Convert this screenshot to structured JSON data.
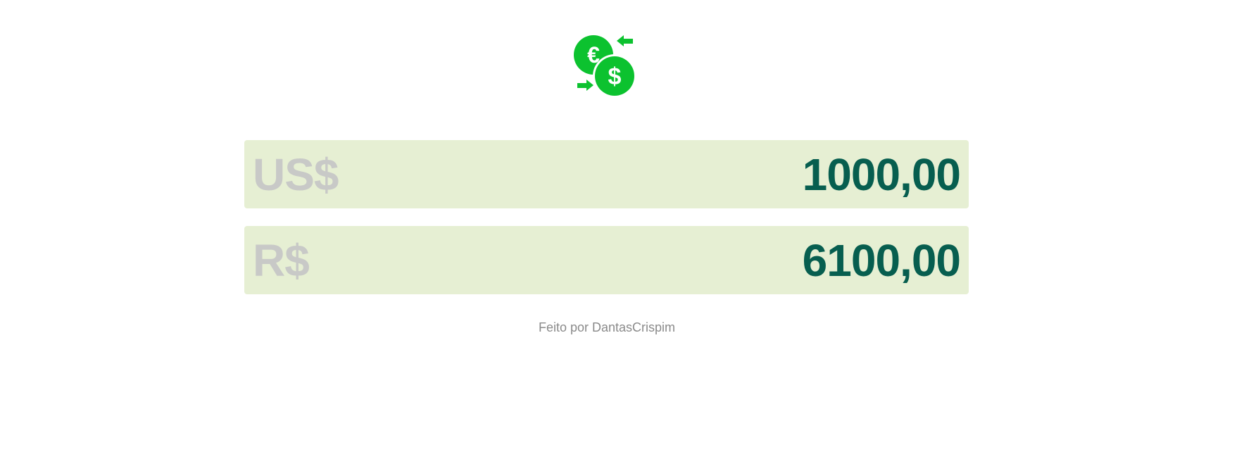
{
  "header": {
    "logo_icon": "currency-exchange-icon",
    "logo_color": "#0cc22f"
  },
  "converter": {
    "usd": {
      "label": "US$",
      "value": "1000,00"
    },
    "brl": {
      "label": "R$",
      "value": "6100,00"
    },
    "field_background": "#e6efd3",
    "label_color": "#c8c9c7",
    "value_color": "#075e4f"
  },
  "footer": {
    "text": "Feito por DantasCrispim"
  }
}
